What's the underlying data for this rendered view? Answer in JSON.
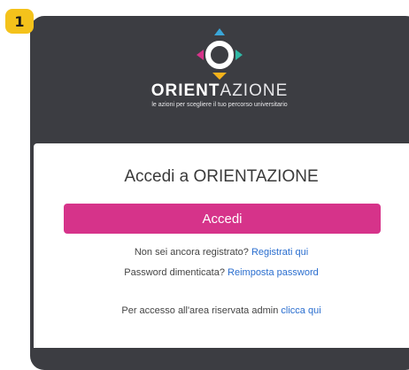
{
  "step": {
    "number": "1"
  },
  "brand": {
    "name_bold": "ORIENT",
    "name_light": "AZIONE",
    "tagline": "le azioni per scegliere il tuo percorso universitario",
    "logo_icon": "orientation-compass-logo-icon",
    "colors": {
      "top": "#3aa6d8",
      "left": "#d6338a",
      "right": "#2fb7a4",
      "bottom": "#f4b21b"
    }
  },
  "card": {
    "title": "Accedi a ORIENTAZIONE",
    "login_button": "Accedi",
    "register_prompt": "Non sei ancora registrato?",
    "register_link": "Registrati qui",
    "forgot_prompt": "Password dimenticata?",
    "forgot_link": "Reimposta password",
    "admin_prompt": "Per accesso all'area riservata admin",
    "admin_link": "clicca qui"
  },
  "colors": {
    "accent": "#d6338a",
    "link": "#2a6ecf",
    "header_bg": "#3c3d42",
    "badge": "#f4c21b"
  }
}
